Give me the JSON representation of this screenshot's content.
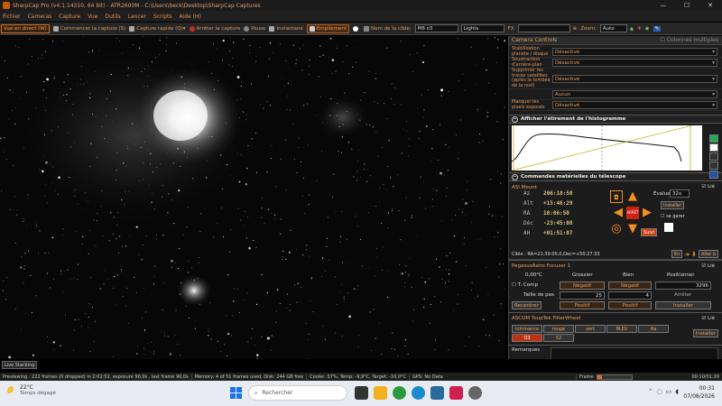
{
  "window": {
    "title": "SharpCap Pro (v4.1.14310, 64 bit) - ATR2600M - C:\\Users\\beck\\Desktop\\SharpCap Captures"
  },
  "menu": [
    "Fichier",
    "Cameras",
    "Capture",
    "Vue",
    "Outils",
    "Lancer",
    "Scripts",
    "Aide (H)"
  ],
  "toolbar": {
    "live": "Vue en direct (W)",
    "start_capture": "Commencer la capture (S)",
    "quick_capture": "Capture rapide (Q)",
    "stop_capture": "Arrêter la capture",
    "pause": "Pause",
    "snapshot": "Instantané",
    "stacking": "Empilement",
    "target_label": "Nom de la cible:",
    "target_value": "M8 o3",
    "lights": "Lights",
    "fx_label": "FX",
    "zoom_label": "Zoom:",
    "zoom_value": "Auto"
  },
  "camera_controls": {
    "title": "Camera Controls",
    "multi_columns": "Colonnes multiples",
    "rows": [
      {
        "label": "Stabilisation planète / disque",
        "value": "Désactivé"
      },
      {
        "label": "Soustraction d'arrière-plan",
        "value": "Désactivé"
      },
      {
        "label": "Supprimer les traces satellites",
        "value": "Désactivé"
      },
      {
        "label": "Aucun",
        "value": "Aucun"
      },
      {
        "label": "Masquer les pixels exposés",
        "value": "Désactivé"
      }
    ],
    "rows_labels": [
      "Stabilisation planète / disque",
      "Soustraction d'arrière-plan",
      "Supprimer les traces satellites (après la tombée de la nuit)",
      "",
      "Masquer les pixels exposés"
    ],
    "rows_values": [
      "Désactivé",
      "Désactivé",
      "Désactivé",
      "Aucun",
      "Désactivé"
    ]
  },
  "histogram": {
    "title": "Afficher l'étirement de l'histogramme"
  },
  "telescope": {
    "title": "Commandes matérielles du télescope",
    "mount_name": "ASI Mount",
    "linked": "Lié",
    "az_label": "Az",
    "az": "206:18:50",
    "alt_label": "Alt",
    "alt": "+15:46:29",
    "ra_label": "RA",
    "ra": "18:06:50",
    "dec_label": "Déc",
    "dec": "-23:45:08",
    "ah_label": "AH",
    "ah": "+01:51:07",
    "evaluer_label": "Évaluer:",
    "evaluer_value": "32x",
    "install": "Installer",
    "park": "se garer",
    "stop": "ARRÊT",
    "follow": "Suivi",
    "target": "Cible : RA=21:39:05,0,Dec=+50:27:33",
    "goto": "Aller à",
    "en": "En"
  },
  "focuser": {
    "name": "PegasusAstro Focuser 1",
    "linked": "Lié",
    "temp": "0,00°C",
    "t_comp": "T. Comp",
    "coarse": "Grossier",
    "fine": "Bien",
    "position_label": "Positionner",
    "neg": "Négatif",
    "neg2": "Négatif",
    "position": "3296",
    "step_label": "Taille de pas",
    "step_coarse": "25",
    "step_fine": "4",
    "stop": "Arrêter",
    "recenter": "Recentrer",
    "pos": "Positif",
    "pos2": "Positif",
    "install": "Installer"
  },
  "filterwheel": {
    "name": "ASCOM ToupTek FilterWheel",
    "linked": "Lié",
    "filters": [
      "luminance",
      "rouge",
      "vert",
      "BLEU",
      "Ha",
      "O3",
      "S2"
    ],
    "install": "Installer",
    "remarks": "Remarques"
  },
  "status": {
    "live_stacking": "Live Stacking",
    "previewing": "Previewing : 222 frames (0 dropped) in 2:02:52, exposure 90,0s , last frame 90,0s",
    "memory": "Memory: 4 of 51 frames used, Disk: 244 GB free",
    "cooler": "Cooler: 57%, Temp: -9,9°C, Target: -10,0°C",
    "gps": "GPS: No Data",
    "frame_label": "Frame",
    "elapsed": "00:10/01:20"
  },
  "taskbar": {
    "temp": "22°C",
    "weather": "Temps dégagé",
    "search": "Rechercher",
    "time": "00:31",
    "date": "07/08/2026"
  }
}
